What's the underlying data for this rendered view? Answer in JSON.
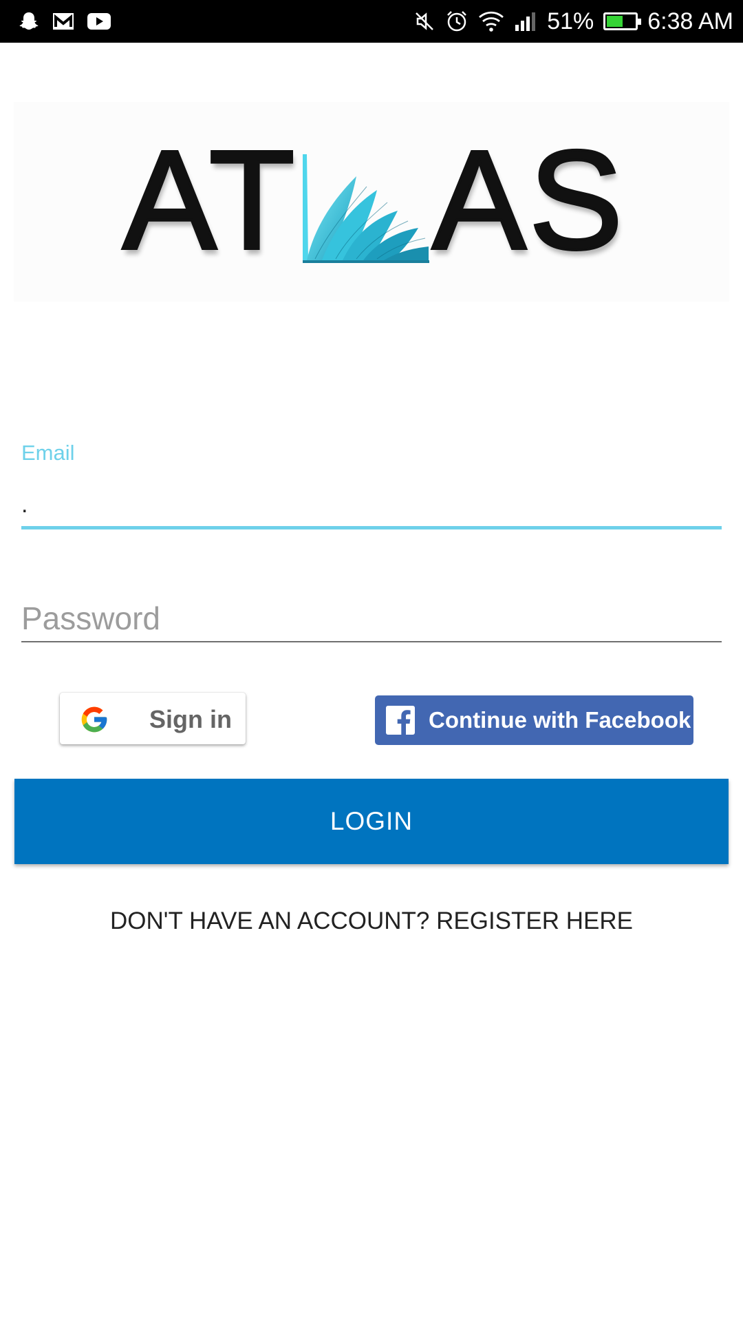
{
  "status_bar": {
    "left_icons": [
      "snapchat-icon",
      "gmail-icon",
      "youtube-icon"
    ],
    "right_icons": [
      "mute-icon",
      "alarm-icon",
      "wifi-icon",
      "signal-icon"
    ],
    "battery_percent": "51%",
    "battery_level": 0.51,
    "time": "6:38 AM"
  },
  "logo": {
    "text_left": "AT",
    "text_right": "AS",
    "image": "open-book-icon",
    "book_color": "#3fd0e6"
  },
  "form": {
    "email_label": "Email",
    "email_value": ".",
    "password_placeholder": "Password",
    "accent_color": "#6ed1ea"
  },
  "social": {
    "google_label": "Sign in",
    "facebook_label": "Continue with Facebook",
    "facebook_color": "#4267b2"
  },
  "login_label": "LOGIN",
  "login_color": "#0074bf",
  "register_label": "DON'T HAVE AN ACCOUNT? REGISTER HERE"
}
